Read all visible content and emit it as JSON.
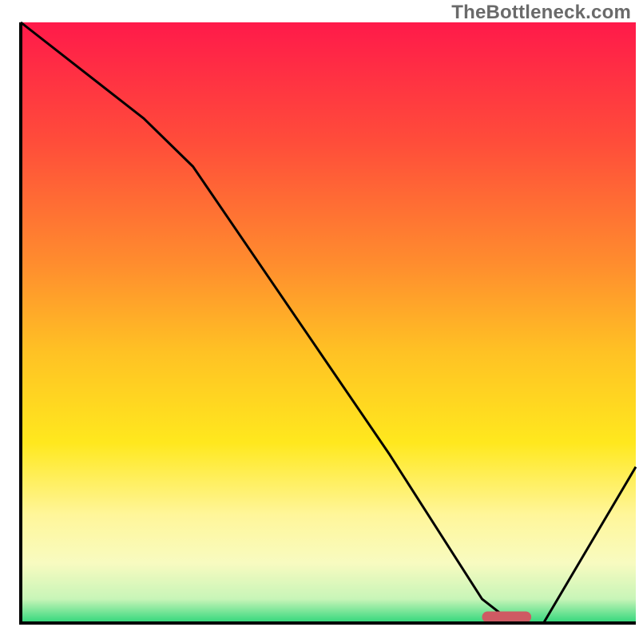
{
  "watermark": "TheBottleneck.com",
  "chart_data": {
    "type": "line",
    "title": "",
    "xlabel": "",
    "ylabel": "",
    "xlim": [
      0,
      100
    ],
    "ylim": [
      0,
      100
    ],
    "x": [
      0,
      10,
      20,
      28,
      40,
      50,
      60,
      70,
      75,
      80,
      85,
      100
    ],
    "values": [
      100,
      92,
      84,
      76,
      58,
      43,
      28,
      12,
      4,
      0,
      0,
      26
    ],
    "marker": {
      "x_start": 75,
      "x_end": 83,
      "y": 1
    },
    "gradient_stops": [
      {
        "offset": 0.0,
        "color": "#ff1a4a"
      },
      {
        "offset": 0.2,
        "color": "#ff4d3a"
      },
      {
        "offset": 0.4,
        "color": "#ff8c2e"
      },
      {
        "offset": 0.55,
        "color": "#ffc224"
      },
      {
        "offset": 0.7,
        "color": "#ffe81e"
      },
      {
        "offset": 0.82,
        "color": "#fff69a"
      },
      {
        "offset": 0.9,
        "color": "#f8fbc0"
      },
      {
        "offset": 0.96,
        "color": "#c8f5b8"
      },
      {
        "offset": 1.0,
        "color": "#2fd77a"
      }
    ],
    "colors": {
      "axis": "#000000",
      "curve": "#000000",
      "marker_fill": "#cf5a63",
      "background": "#ffffff"
    }
  }
}
